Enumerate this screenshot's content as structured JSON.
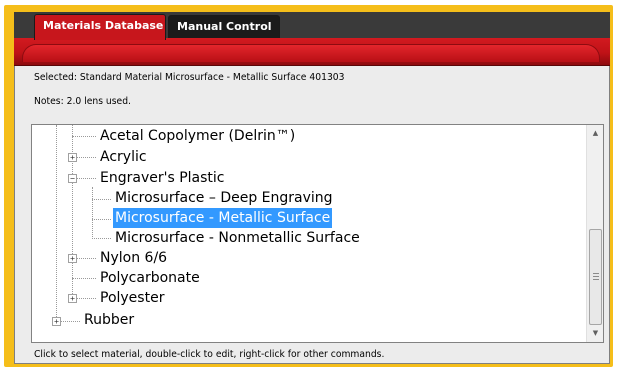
{
  "tabs": [
    {
      "label": "Materials Database",
      "active": true
    },
    {
      "label": "Manual Control",
      "active": false
    }
  ],
  "info": {
    "selected": "Selected: Standard Material Microsurface - Metallic Surface 401303",
    "notes": "Notes: 2.0 lens used."
  },
  "tree": {
    "items": [
      {
        "label": "Acetal Copolymer (Delrin™)",
        "level": 1,
        "expander": "none"
      },
      {
        "label": "Acrylic",
        "level": 1,
        "expander": "plus"
      },
      {
        "label": "Engraver's Plastic",
        "level": 1,
        "expander": "minus"
      },
      {
        "label": "Microsurface – Deep Engraving",
        "level": 2,
        "expander": "none"
      },
      {
        "label": "Microsurface - Metallic Surface",
        "level": 2,
        "expander": "none",
        "selected": true
      },
      {
        "label": "Microsurface - Nonmetallic Surface",
        "level": 2,
        "expander": "none"
      },
      {
        "label": "Nylon 6/6",
        "level": 1,
        "expander": "plus"
      },
      {
        "label": "Polycarbonate",
        "level": 1,
        "expander": "none"
      },
      {
        "label": "Polyester",
        "level": 1,
        "expander": "plus"
      },
      {
        "label": "Rubber",
        "level": 0,
        "expander": "plus"
      }
    ]
  },
  "status": "Click to select material, double-click to edit, right-click for other commands.",
  "colors": {
    "frame": "#f5be1a",
    "active_tab": "#c7161c",
    "selection": "#3399ff"
  },
  "icons": {
    "scroll_up": "scroll-up-arrow-icon",
    "scroll_down": "scroll-down-arrow-icon",
    "expand": "plus-box-icon",
    "collapse": "minus-box-icon"
  }
}
